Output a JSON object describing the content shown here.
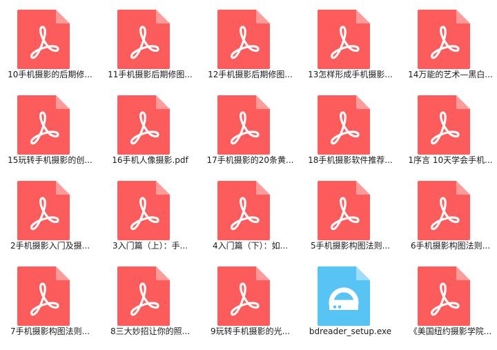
{
  "colors": {
    "pdf_body": "#fc5c5c",
    "pdf_fold": "#fd9b9b",
    "pdf_glyph": "#ffffff",
    "exe_body": "#58c4f4",
    "exe_fold": "#9fdcf8",
    "exe_glyph": "#ffffff",
    "label_text": "#1a1a1a"
  },
  "files": [
    {
      "label": "10手机摄影的后期修...",
      "icon": "pdf-icon"
    },
    {
      "label": "11手机摄影后期修图...",
      "icon": "pdf-icon"
    },
    {
      "label": "12手机摄影后期修图...",
      "icon": "pdf-icon"
    },
    {
      "label": "13怎样形成手机摄影...",
      "icon": "pdf-icon"
    },
    {
      "label": "14万能的艺术—黑白...",
      "icon": "pdf-icon"
    },
    {
      "label": "15玩转手机摄影的创...",
      "icon": "pdf-icon"
    },
    {
      "label": "16手机人像摄影.pdf",
      "icon": "pdf-icon"
    },
    {
      "label": "17手机摄影的20条黄...",
      "icon": "pdf-icon"
    },
    {
      "label": "18手机摄影软件推荐...",
      "icon": "pdf-icon"
    },
    {
      "label": "1序言 10天学会手机...",
      "icon": "pdf-icon"
    },
    {
      "label": "2手机摄影入门及摄...",
      "icon": "pdf-icon"
    },
    {
      "label": "3入门篇（上）：手...",
      "icon": "pdf-icon"
    },
    {
      "label": "4入门篇（下）：如...",
      "icon": "pdf-icon"
    },
    {
      "label": "5手机摄影构图法则...",
      "icon": "pdf-icon"
    },
    {
      "label": "6手机摄影构图法则...",
      "icon": "pdf-icon"
    },
    {
      "label": "7手机摄影构图法则...",
      "icon": "pdf-icon"
    },
    {
      "label": "8三大妙招让你的照...",
      "icon": "pdf-icon"
    },
    {
      "label": "9玩转手机摄影的光...",
      "icon": "pdf-icon"
    },
    {
      "label": "bdreader_setup.exe",
      "icon": "installer-icon"
    },
    {
      "label": "《美国纽约摄影学院...",
      "icon": "pdf-icon"
    }
  ]
}
